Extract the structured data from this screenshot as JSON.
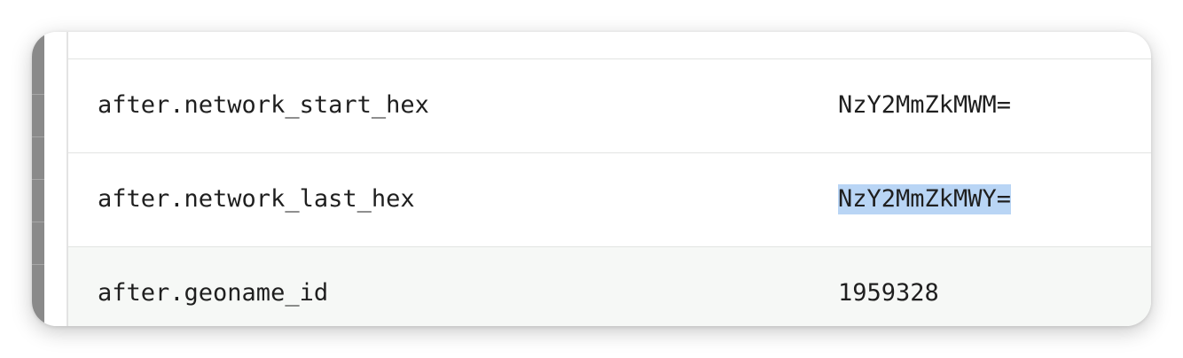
{
  "rows": [
    {
      "key": "after.network_start_hex",
      "value": "NzY2MmZkMWM="
    },
    {
      "key": "after.network_last_hex",
      "value": "NzY2MmZkMWY=",
      "selected": true
    },
    {
      "key": "after.geoname_id",
      "value": "1959328"
    }
  ],
  "colors": {
    "selection": "#b9d5f5",
    "stripe_row": "#f6f8f6",
    "divider": "#e2e4e2",
    "left_strip": "#8a8a8a"
  }
}
